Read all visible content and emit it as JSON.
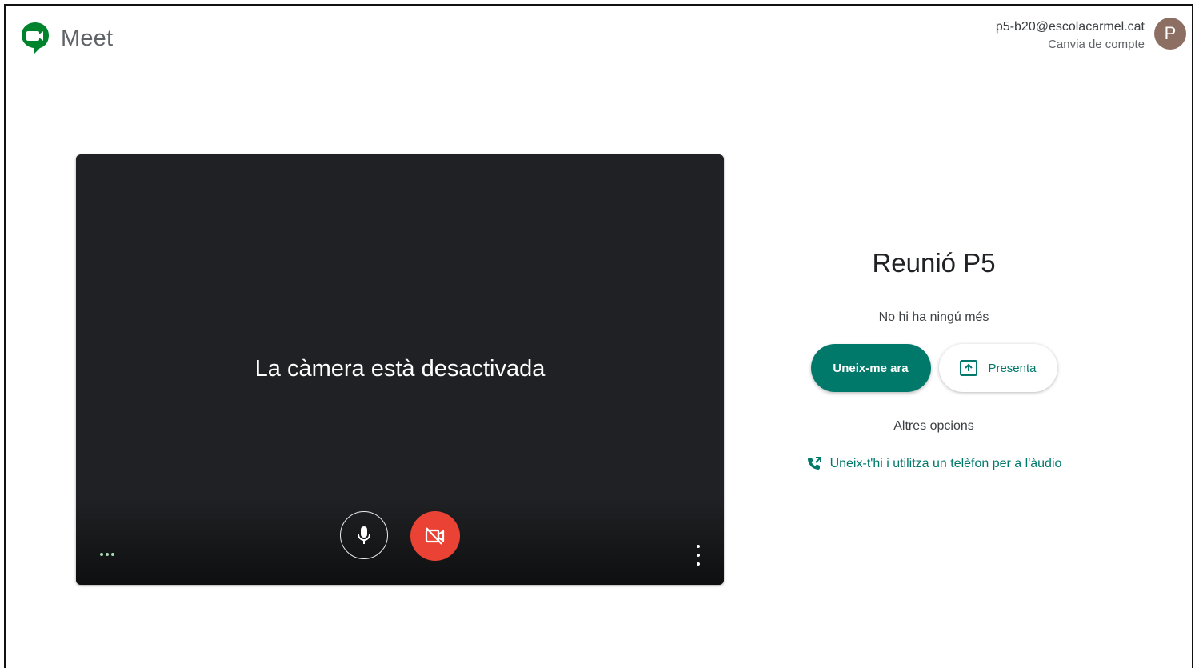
{
  "app": {
    "name": "Meet",
    "icon": "google-meet-icon",
    "brand_colors": {
      "green": "#00832d",
      "teal": "#00796b",
      "red": "#ea4335"
    }
  },
  "account": {
    "email": "p5-b20@escolacarmel.cat",
    "switch_label": "Canvia de compte",
    "avatar_initial": "P",
    "avatar_color": "#8d6e63"
  },
  "preview": {
    "camera_off_message": "La càmera està desactivada",
    "mic_icon": "microphone-icon",
    "camera_icon": "camera-off-icon",
    "more_icon": "more-vert-icon",
    "indicator_icon": "audio-level-dots-icon"
  },
  "panel": {
    "meeting_title": "Reunió P5",
    "participants_status": "No hi ha ningú més",
    "join_button": "Uneix-me ara",
    "present_button": "Presenta",
    "present_icon": "present-screen-icon",
    "other_options": "Altres opcions",
    "phone_link": "Uneix-t'hi i utilitza un telèfon per a l'àudio",
    "phone_icon": "phone-forward-icon"
  }
}
